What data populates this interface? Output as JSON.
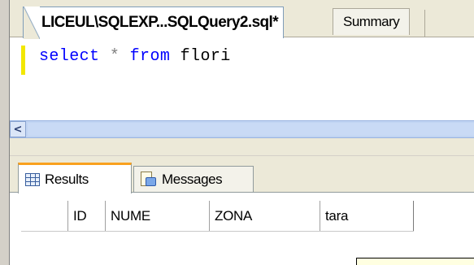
{
  "document_tabs": [
    {
      "label": "LICEUL\\SQLEXP...SQLQuery2.sql*",
      "active": true
    },
    {
      "label": "Summary",
      "active": false
    }
  ],
  "editor": {
    "code": {
      "keyword_select": "select",
      "operator_star": "*",
      "keyword_from": "from",
      "table_name": "flori"
    }
  },
  "scrollbar": {
    "left_arrow": "<"
  },
  "results_tabs": [
    {
      "label": "Results",
      "icon": "grid-icon",
      "active": true
    },
    {
      "label": "Messages",
      "icon": "messages-icon",
      "active": false
    }
  ],
  "results_grid": {
    "columns": [
      "ID",
      "NUME",
      "ZONA",
      "tara"
    ]
  },
  "colors": {
    "keyword": "#0000ff",
    "operator": "#808080",
    "active_tab_accent": "#f9a11e",
    "edit_marker": "#f2e700"
  }
}
